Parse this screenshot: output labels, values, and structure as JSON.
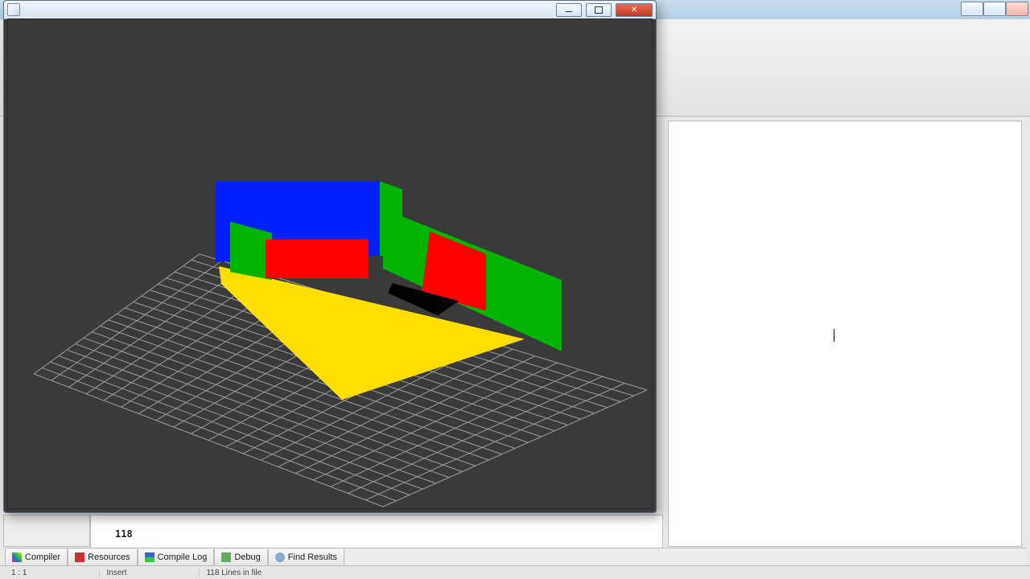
{
  "ide": {
    "tabs": {
      "compiler": "Compiler",
      "resources": "Resources",
      "compileLog": "Compile Log",
      "debug": "Debug",
      "findResults": "Find Results"
    },
    "editor": {
      "lineNumber": "118"
    },
    "status": {
      "pos": "1 : 1",
      "mode": "Insert",
      "info": "118 Lines in file"
    }
  },
  "glWindow": {
    "title": "",
    "scene": {
      "background": "#3a3a3a",
      "gridColor": "#9a9a9a",
      "floorColor": "#ffde00",
      "walls": {
        "back": "#0020ff",
        "backSide": "#00b400",
        "leftInner": "#00b400",
        "rightOuter": "#00b400"
      },
      "cubes": {
        "left": "#ff0000",
        "right": "#ff0000"
      },
      "shadowColor": "#000000"
    }
  }
}
